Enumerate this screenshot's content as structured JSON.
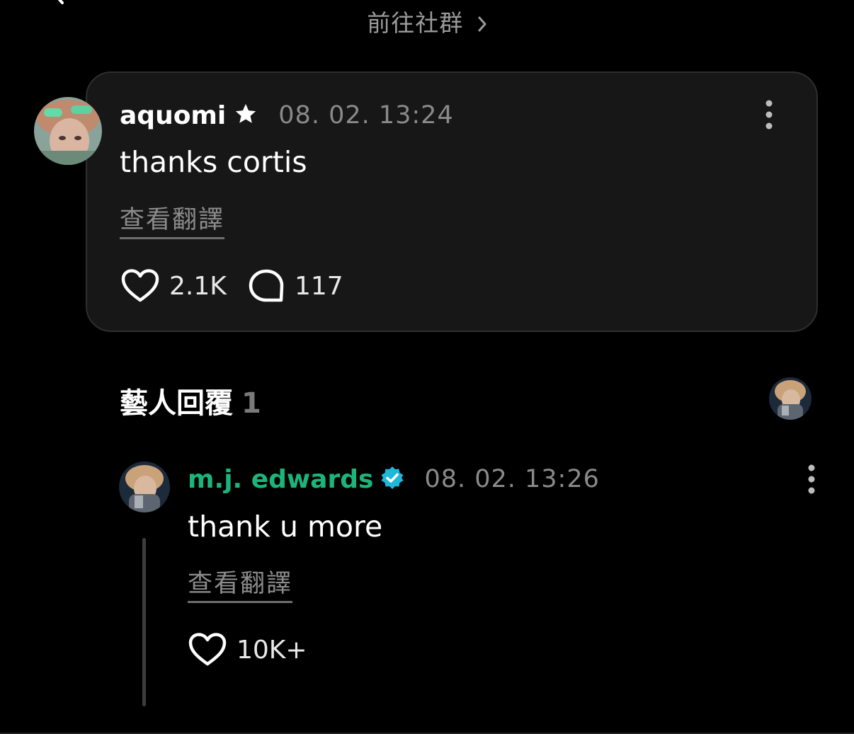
{
  "header": {
    "community_link": "前往社群"
  },
  "post": {
    "username": "aquomi",
    "timestamp": "08. 02. 13:24",
    "text": "thanks cortis",
    "translate_label": "查看翻譯",
    "likes": "2.1K",
    "comments": "117"
  },
  "artist_replies": {
    "title": "藝人回覆",
    "count": "1"
  },
  "reply": {
    "username": "m.j. edwards",
    "timestamp": "08. 02. 13:26",
    "text": "thank u more",
    "translate_label": "查看翻譯",
    "likes": "10K+"
  },
  "colors": {
    "artist_name": "#1bb57a",
    "verified_badge": "#1fb8d8",
    "card_background": "#171717"
  },
  "icons": [
    "back-icon",
    "chevron-right-icon",
    "star-icon",
    "more-vertical-icon",
    "heart-icon",
    "comment-icon",
    "verified-icon"
  ]
}
